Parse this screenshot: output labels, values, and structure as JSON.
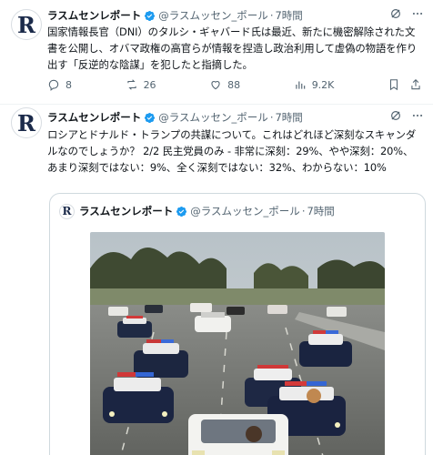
{
  "colors": {
    "accent": "#1d9bf0",
    "muted": "#536471",
    "text": "#0f1419",
    "border": "#cfd9de"
  },
  "tweet1": {
    "avatar_letter": "R",
    "name": "ラスムセンレポート",
    "handle": "@ラスムッセン_ポール",
    "dot": "·",
    "time": "7時間",
    "text": "国家情報長官（DNI）のタルシ・ギャバード氏は最近、新たに機密解除された文書を公開し、オバマ政権の高官らが情報を捏造し政治利用して虚偽の物語を作り出す「反逆的な陰謀」を犯したと指摘した。",
    "actions": {
      "replies": "8",
      "reposts": "26",
      "likes": "88",
      "views": "9.2K"
    }
  },
  "tweet2": {
    "avatar_letter": "R",
    "name": "ラスムセンレポート",
    "handle": "@ラスムッセン_ポール",
    "dot": "·",
    "time": "7時間",
    "text": "ロシアとドナルド・トランプの共謀について。これはどれほど深刻なスキャンダルなのでしょうか？ 2/2 民主党員のみ - 非常に深刻：29%、やや深刻：20%、あまり深刻ではない：9%、全く深刻ではない：32%、わからない：10%",
    "quote": {
      "avatar_letter": "R",
      "name": "ラスムセンレポート",
      "handle": "@ラスムッセン_ポール",
      "dot": "·",
      "time": "7時間"
    }
  }
}
